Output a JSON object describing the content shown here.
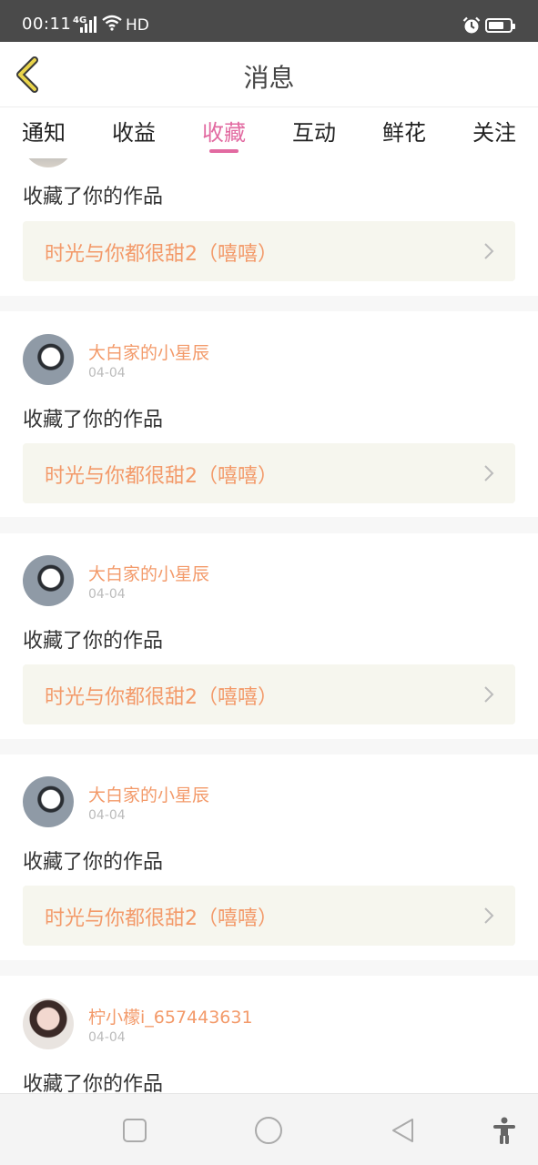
{
  "status_bar": {
    "time": "00:11",
    "network": "4G",
    "hd": "HD",
    "battery_level": 0.6,
    "icons": [
      "signal-icon",
      "wifi-icon",
      "alarm-icon",
      "battery-icon"
    ]
  },
  "header": {
    "title": "消息",
    "back_icon": "chevron-left-icon",
    "accent": "#e9d44a"
  },
  "tabs": [
    {
      "label": "通知",
      "active": false
    },
    {
      "label": "收益",
      "active": false
    },
    {
      "label": "收藏",
      "active": true
    },
    {
      "label": "互动",
      "active": false
    },
    {
      "label": "鲜花",
      "active": false
    },
    {
      "label": "关注",
      "active": false
    }
  ],
  "colors": {
    "active_tab": "#e26aa1",
    "username": "#f39a6a",
    "work_title": "#f39a6a",
    "work_box_bg": "#f6f6ee"
  },
  "partial_card": {
    "action": "收藏了你的作品",
    "work_title": "时光与你都很甜2（嘻嘻）"
  },
  "cards": [
    {
      "username": "大白家的小星辰",
      "date": "04-04",
      "action": "收藏了你的作品",
      "work_title": "时光与你都很甜2（嘻嘻）"
    },
    {
      "username": "大白家的小星辰",
      "date": "04-04",
      "action": "收藏了你的作品",
      "work_title": "时光与你都很甜2（嘻嘻）"
    },
    {
      "username": "大白家的小星辰",
      "date": "04-04",
      "action": "收藏了你的作品",
      "work_title": "时光与你都很甜2（嘻嘻）"
    },
    {
      "username": "柠小檬i_657443631",
      "date": "04-04",
      "action": "收藏了你的作品"
    }
  ],
  "bottom_nav": {
    "icons": [
      "square-icon",
      "circle-icon",
      "triangle-back-icon",
      "accessibility-icon"
    ]
  }
}
